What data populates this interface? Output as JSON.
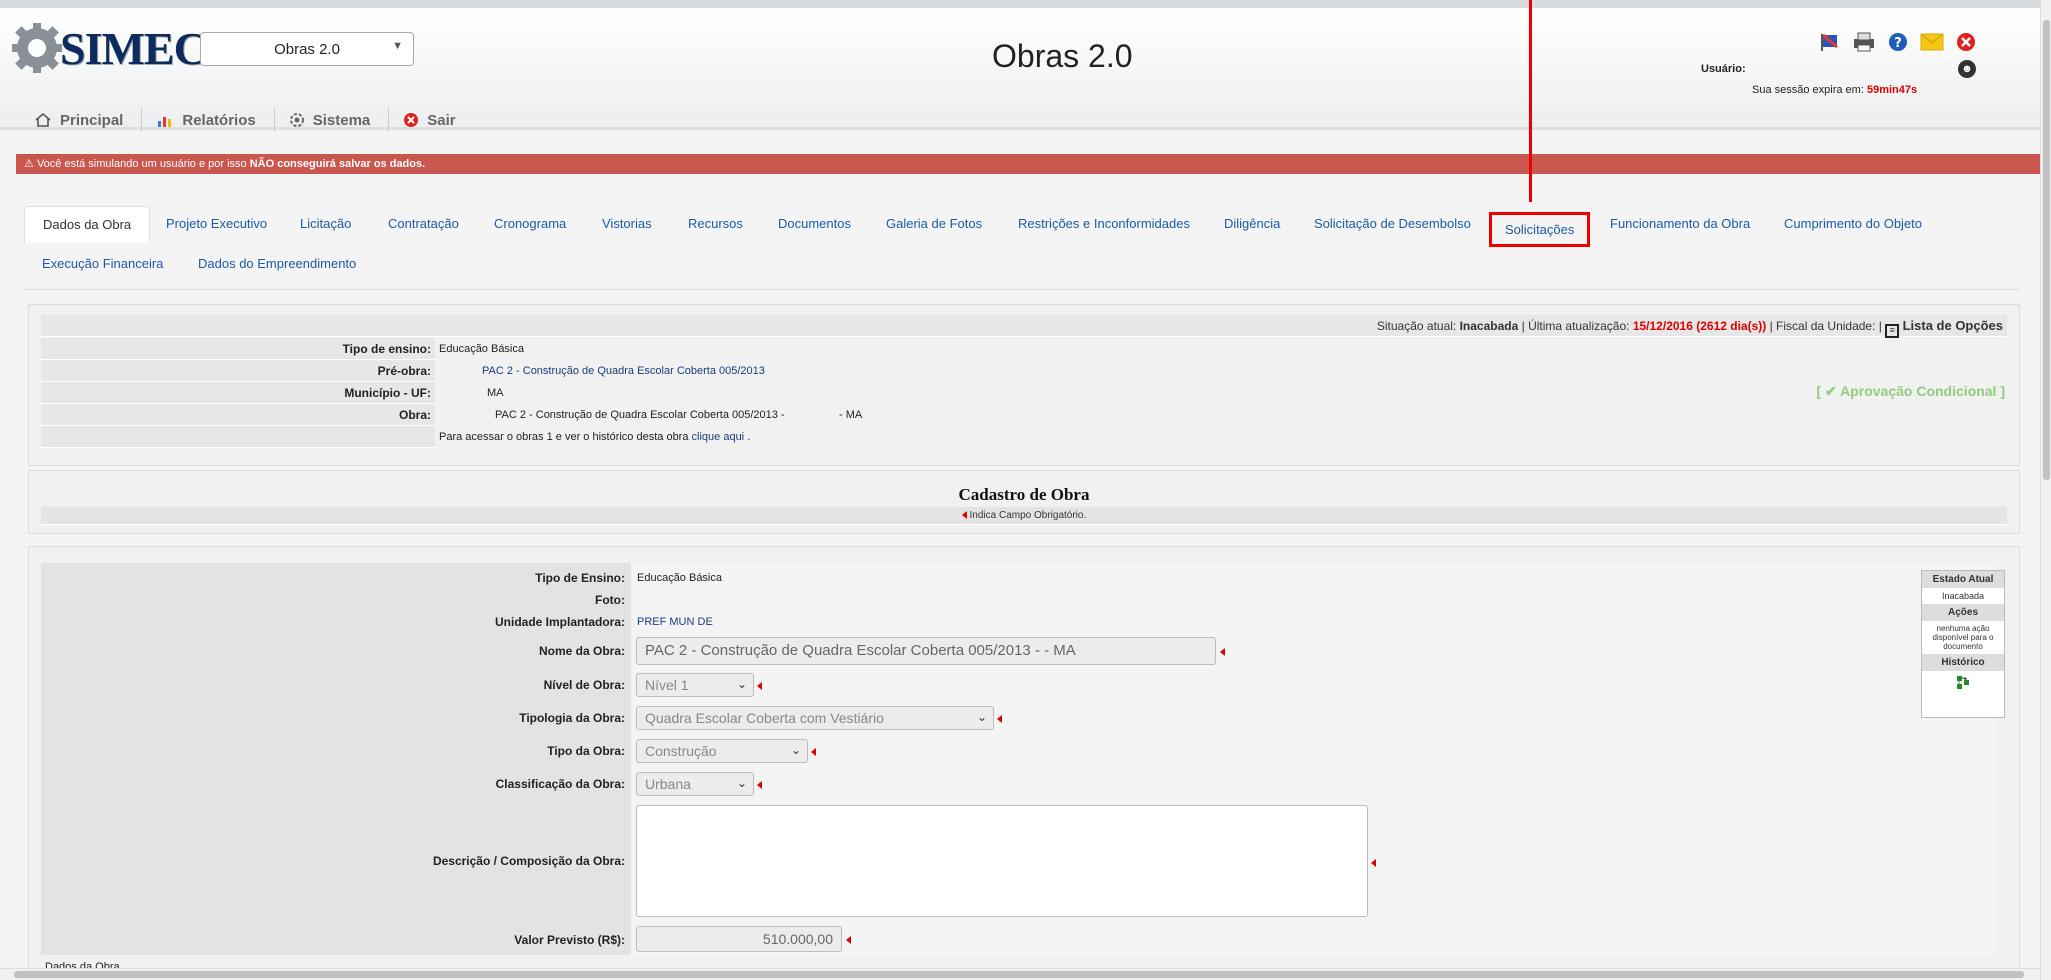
{
  "header": {
    "logo": "SIMEC",
    "system_select": "Obras 2.0",
    "title": "Obras 2.0",
    "user_label": "Usuário:",
    "session_label": "Sua sessão expira em:",
    "session_time": "59min47s",
    "icons": [
      "flag-icon",
      "printer-icon",
      "help-icon",
      "mail-icon",
      "close-icon"
    ]
  },
  "menu": {
    "items": [
      "Principal",
      "Relatórios",
      "Sistema",
      "Sair"
    ]
  },
  "warning": {
    "text_before": "Você está simulando um usuário e por isso ",
    "text_bold": "NÃO conseguirá salvar os dados."
  },
  "tabs": [
    "Dados da Obra",
    "Projeto Executivo",
    "Licitação",
    "Contratação",
    "Cronograma",
    "Vistorias",
    "Recursos",
    "Documentos",
    "Galeria de Fotos",
    "Restrições e Inconformidades",
    "Diligência",
    "Solicitação de Desembolso",
    "Solicitações",
    "Funcionamento da Obra",
    "Cumprimento do Objeto",
    "Execução Financeira",
    "Dados do Empreendimento"
  ],
  "summary": {
    "status_prefix": "Situação atual:",
    "status": "Inacabada",
    "update_prefix": "| Última atualização:",
    "update": "15/12/2016 (2612 dia(s))",
    "fiscal": "| Fiscal da Unidade: |",
    "options": "Lista de Opções",
    "approval": "[ ✔ Aprovação Condicional ]",
    "tipo_label": "Tipo de ensino:",
    "tipo_value": "Educação Básica",
    "preobra_label": "Pré-obra:",
    "preobra_value": "PAC 2 - Construção de Quadra Escolar Coberta 005/2013",
    "municipio_label": "Município - UF:",
    "municipio_value": "MA",
    "obra_label": "Obra:",
    "obra_value": "PAC 2 - Construção de Quadra Escolar Coberta 005/2013 -",
    "obra_uf": "- MA",
    "access_text": "Para acessar o obras 1 e ver o histórico desta obra",
    "access_link": "clique aqui",
    "access_end": "."
  },
  "cadastro": {
    "title": "Cadastro de Obra",
    "required_note": "Indica Campo Obrigatório."
  },
  "form": {
    "tipo_ensino_label": "Tipo de Ensino:",
    "tipo_ensino_value": "Educação Básica",
    "foto_label": "Foto:",
    "unidade_label": "Unidade Implantadora:",
    "unidade_value": "PREF MUN DE",
    "nome_label": "Nome da Obra:",
    "nome_value": "PAC 2 - Construção de Quadra Escolar Coberta  005/2013 -              - MA",
    "nivel_label": "Nível de Obra:",
    "nivel_value": "Nível 1",
    "tipologia_label": "Tipologia da Obra:",
    "tipologia_value": "Quadra Escolar Coberta com Vestiário",
    "tipo_obra_label": "Tipo da Obra:",
    "tipo_obra_value": "Construção",
    "classificacao_label": "Classificação da Obra:",
    "classificacao_value": "Urbana",
    "descricao_label": "Descrição / Composição da Obra:",
    "descricao_value": "",
    "valor_label": "Valor Previsto (R$):",
    "valor_value": "510.000,00",
    "footer_text": "Dados da Obra"
  },
  "workflow": {
    "estado_label": "Estado Atual",
    "estado_value": "Inacabada",
    "acoes_label": "Ações",
    "acoes_value": "nenhuma ação disponível para o documento",
    "historico_label": "Histórico"
  }
}
